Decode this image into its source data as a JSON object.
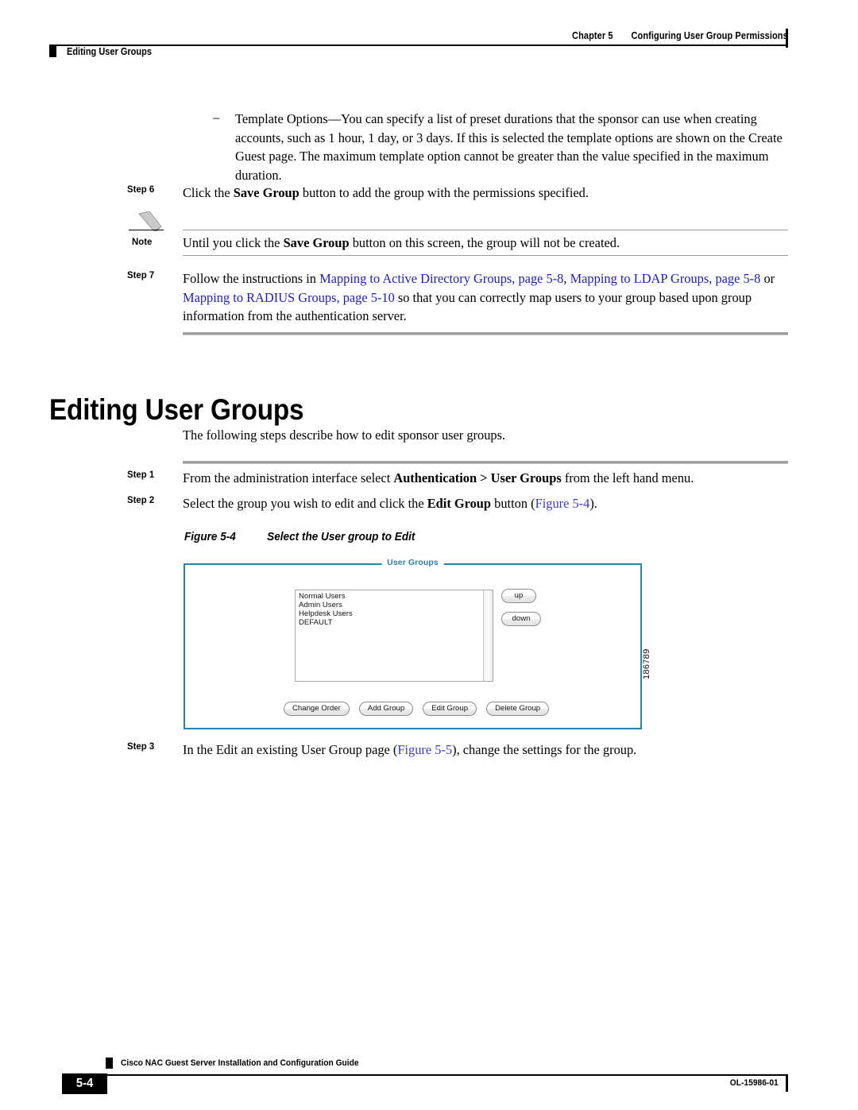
{
  "header": {
    "chapter": "Chapter 5",
    "chapter_title": "Configuring User Group Permissions",
    "running_head": "Editing User Groups"
  },
  "bullet": {
    "dash": "–",
    "lead": "Template Options",
    "text": "—You can specify a list of preset durations that the sponsor can use when creating accounts, such as 1 hour, 1 day, or 3 days. If this is selected the template options are shown on the Create Guest page. The maximum template option cannot be greater than the value specified in the maximum duration."
  },
  "step6": {
    "label": "Step 6",
    "t1": "Click the ",
    "bold": "Save Group",
    "t2": " button to add the group with the permissions specified."
  },
  "note": {
    "label": "Note",
    "t1": "Until you click the ",
    "bold": "Save Group",
    "t2": " button on this screen, the group will not be created."
  },
  "step7": {
    "label": "Step 7",
    "t1": "Follow the instructions in ",
    "link1": "Mapping to Active Directory Groups, page 5-8",
    "t2": ", ",
    "link2": "Mapping to LDAP Groups, page 5-8",
    "t3": " or ",
    "link3": "Mapping to RADIUS Groups, page 5-10",
    "t4": " so that you can correctly map users to your group based upon group information from the authentication server."
  },
  "section": {
    "heading": "Editing User Groups",
    "intro": "The following steps describe how to edit sponsor user groups."
  },
  "step1": {
    "label": "Step 1",
    "t1": "From the administration interface select ",
    "bold": "Authentication > User Groups",
    "t2": " from the left hand menu."
  },
  "step2": {
    "label": "Step 2",
    "t1": "Select the group you wish to edit and click the ",
    "bold": "Edit Group",
    "t2": " button (",
    "link": "Figure 5-4",
    "t3": ")."
  },
  "step3": {
    "label": "Step 3",
    "t1": "In the Edit an existing User Group page (",
    "link": "Figure 5-5",
    "t2": "), change the settings for the group."
  },
  "figure": {
    "caption_number": "Figure 5-4",
    "caption_title": "Select the User group to Edit",
    "legend": "User Groups",
    "list_items": [
      "Normal Users",
      "Admin Users",
      "Helpdesk Users",
      "DEFAULT"
    ],
    "up_label": "up",
    "down_label": "down",
    "buttons": [
      "Change Order",
      "Add Group",
      "Edit Group",
      "Delete Group"
    ],
    "figure_id": "186789",
    "border_color": "#2e7fa8",
    "legend_color": "#2e7fa8"
  },
  "footer": {
    "page_number": "5-4",
    "guide_title": "Cisco NAC Guest Server Installation and Configuration Guide",
    "doc_number": "OL-15986-01"
  }
}
